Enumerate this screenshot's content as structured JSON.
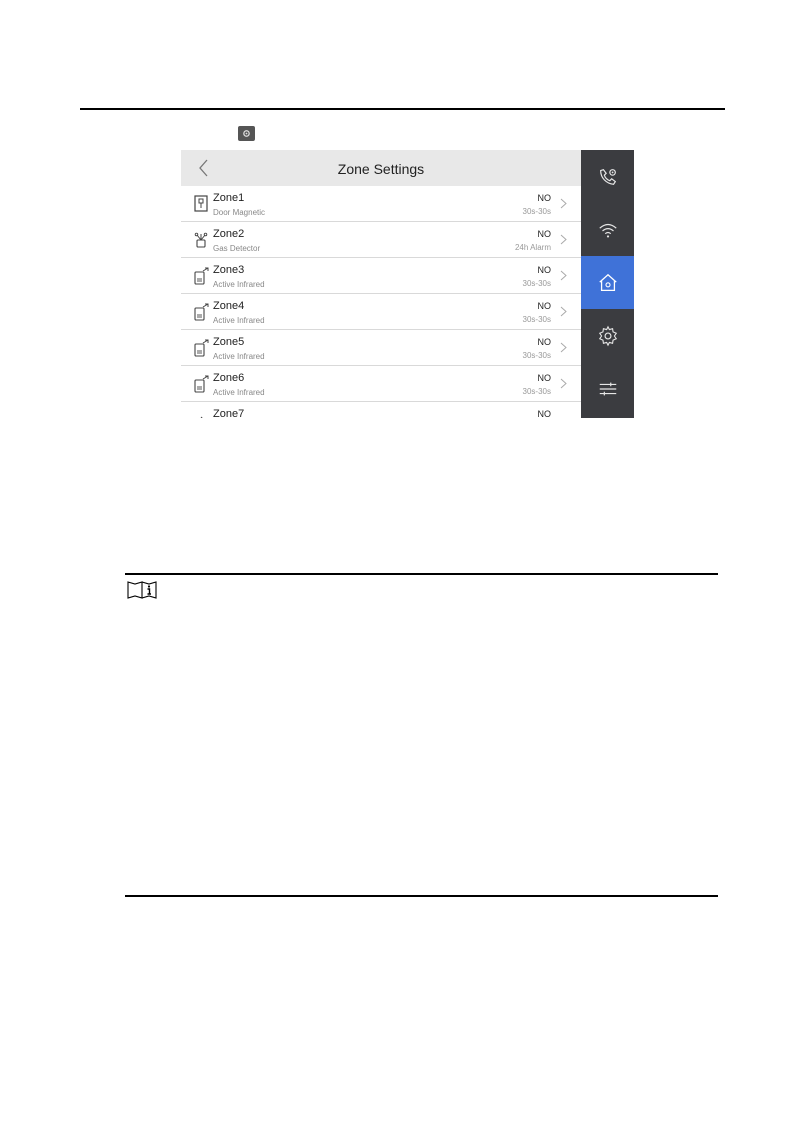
{
  "page": {
    "inline_icon": "settings-gear-icon",
    "note_icon": "note-book-icon"
  },
  "screen": {
    "title": "Zone Settings",
    "back_icon": "chevron-left-icon",
    "zones": [
      {
        "name": "Zone1",
        "type": "Door Magnetic",
        "mode": "NO",
        "delay": "30s-30s",
        "icon": "door-magnetic-icon"
      },
      {
        "name": "Zone2",
        "type": "Gas Detector",
        "mode": "NO",
        "delay": "24h Alarm",
        "icon": "gas-detector-icon"
      },
      {
        "name": "Zone3",
        "type": "Active Infrared",
        "mode": "NO",
        "delay": "30s-30s",
        "icon": "active-infrared-icon"
      },
      {
        "name": "Zone4",
        "type": "Active Infrared",
        "mode": "NO",
        "delay": "30s-30s",
        "icon": "active-infrared-icon"
      },
      {
        "name": "Zone5",
        "type": "Active Infrared",
        "mode": "NO",
        "delay": "30s-30s",
        "icon": "active-infrared-icon"
      },
      {
        "name": "Zone6",
        "type": "Active Infrared",
        "mode": "NO",
        "delay": "30s-30s",
        "icon": "active-infrared-icon"
      },
      {
        "name": "Zone7",
        "type": "",
        "mode": "NO",
        "delay": "",
        "icon": "sensor-icon"
      }
    ],
    "sidebar": [
      {
        "icon": "phone-settings-icon",
        "active": false
      },
      {
        "icon": "wifi-icon",
        "active": false
      },
      {
        "icon": "home-icon",
        "active": true
      },
      {
        "icon": "gear-icon",
        "active": false
      },
      {
        "icon": "sliders-icon",
        "active": false
      }
    ],
    "colors": {
      "active": "#3f72d8",
      "sidebar": "#3b3c40",
      "header": "#e8e8e8"
    }
  }
}
